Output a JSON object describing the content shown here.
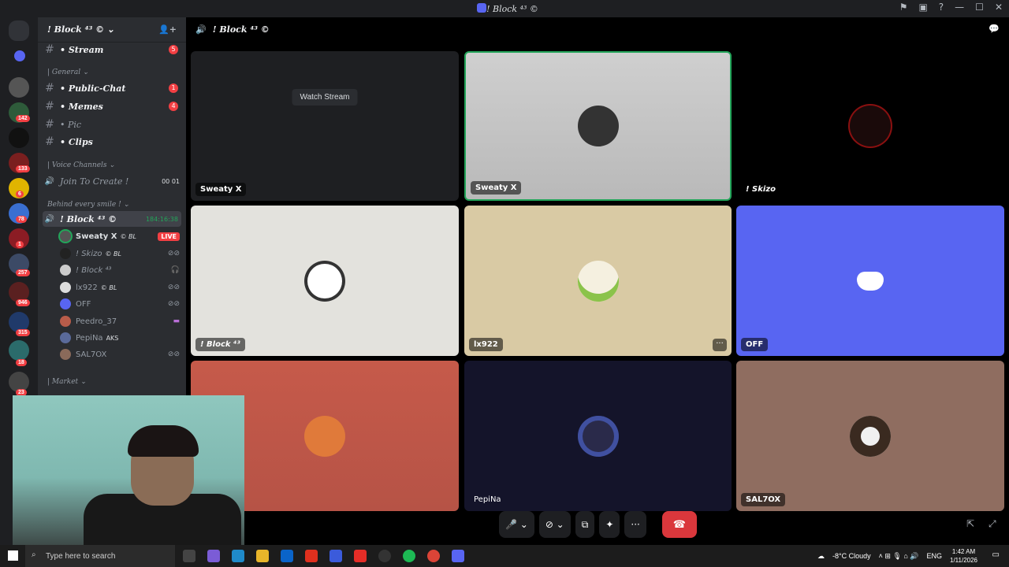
{
  "window": {
    "title": "! Block ⁴³ ©"
  },
  "sidebar": {
    "server_title": "! Block ⁴³ © ⌄",
    "server_badges": [
      "142",
      "133",
      "6",
      "78",
      "1",
      "257",
      "946",
      "315",
      "18",
      "23"
    ],
    "channels": [
      {
        "name": "• Stream",
        "badge": "5"
      },
      {
        "category": "| General ⌄"
      },
      {
        "name": "• Public-Chat",
        "badge": "1"
      },
      {
        "name": "• Memes",
        "badge": "4"
      },
      {
        "name": "• Pic",
        "badge": ""
      },
      {
        "name": "• Clips",
        "badge": ""
      },
      {
        "category": "| Voice Channels ⌄"
      },
      {
        "name": "Join To Create !",
        "extra": "00 01"
      },
      {
        "category": "Behind every smile ! ⌄"
      },
      {
        "name": "! Block ⁴³ ©",
        "extra": "184:16:38"
      }
    ],
    "users": [
      {
        "name": "Sweaty X",
        "tag": "© BL",
        "live": "LIVE"
      },
      {
        "name": "! Skizo",
        "tag": "© BL"
      },
      {
        "name": "! Block ⁴³",
        "tag": ""
      },
      {
        "name": "lx922",
        "tag": "© BL"
      },
      {
        "name": "OFF",
        "tag": ""
      },
      {
        "name": "Peedro_37",
        "tag": ""
      },
      {
        "name": "PepiNa",
        "tag": "AKS"
      },
      {
        "name": "SAL7OX",
        "tag": ""
      }
    ],
    "market_category": "| Market ⌄"
  },
  "stage": {
    "header": "! Block ⁴³ ©",
    "watch_stream": "Watch Stream",
    "tiles": [
      {
        "label": "Sweaty X"
      },
      {
        "label": "Sweaty X"
      },
      {
        "label": "! Skizo"
      },
      {
        "label": "! Block ⁴³"
      },
      {
        "label": "lx922"
      },
      {
        "label": "OFF"
      },
      {
        "label": ""
      },
      {
        "label": "PepiNa"
      },
      {
        "label": "SAL7OX"
      }
    ],
    "more": "···"
  },
  "controls": {
    "mic": "🎤 ⌄",
    "cam": "⊘ ⌄",
    "share": "⧉",
    "activity": "✦",
    "more": "···",
    "hangup": "☎"
  },
  "taskbar": {
    "search_placeholder": "Type here to search",
    "weather": "-8°C  Cloudy",
    "lang": "ENG",
    "time": "1:42 AM",
    "date": "1/11/2026"
  },
  "colors": {
    "blurple": "#5865f2",
    "red": "#da373c",
    "green": "#23a55a"
  }
}
